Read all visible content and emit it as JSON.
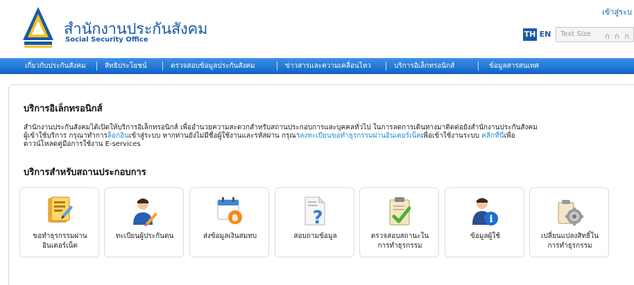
{
  "header": {
    "logo_thai": "สำนักงานประกันสังคม",
    "logo_en": "Social Security Office",
    "login_link": "เข้าสู่ระบ",
    "lang_th": "TH",
    "lang_en": "EN",
    "textsize_label": "Text Size",
    "textsize_options": "ก ก ก"
  },
  "nav": {
    "items": [
      "เกี่ยวกับประกันสังคม",
      "สิทธิประโยชน์",
      "ตรวจสอบข้อมูลประกันสังคม",
      "ข่าวสารและความเคลื่อนไหว",
      "บริการอิเล็กทรอนิกส์",
      "ข้อมูลสารสนเทศ"
    ]
  },
  "main": {
    "title": "บริการอิเล็กทรอนิกส์",
    "intro_line1": "สำนักงานประกันสังคมได้เปิดให้บริการอิเล็กทรอนิกส์ เพื่ออำนวยความสะดวกสำหรับสถานประกอบการและบุคคลทั่วไป ในการลดการเดินทางมาติดต่อยังสำนักงานประกันสังคม",
    "intro_part_a": "ผู้เข้าใช้บริการ กรุณาทำการ",
    "intro_link_login": "ล็อกอิน",
    "intro_part_b": "เข้าสู่ระบบ หากท่านยังไม่มีชื่อผู้ใช้งานและรหัสผ่าน กรุณา",
    "intro_link_register": "ลงทะเบียนขอทำธุรกรรมผ่านอินเตอร์เน็ต",
    "intro_part_c": "เพื่อเข้าใช้งานระบบ ",
    "intro_link_click": "คลิกที่นี่",
    "intro_part_d": "เพื่อ",
    "intro_line3": "ดาวน์โหลดคู่มือการใช้งาน E-services",
    "services_title": "บริการสำหรับสถานประกอบการ"
  },
  "services": [
    {
      "label": "ขอทำธุรกรรมผ่าน อินเตอร์เน็ต",
      "icon": "internet-transaction-icon"
    },
    {
      "label": "ทะเบียนผู้ประกันตน",
      "icon": "insured-registration-icon"
    },
    {
      "label": "ส่งข้อมูลเงินสมทบ",
      "icon": "contribution-submit-icon"
    },
    {
      "label": "สอบถามข้อมูล",
      "icon": "inquiry-icon"
    },
    {
      "label": "ตรวจสอบสถานะใน การทำธุรกรรม",
      "icon": "status-check-icon"
    },
    {
      "label": "ข้อมูลผู้ใช้",
      "icon": "user-info-icon"
    },
    {
      "label": "เปลี่ยนแปลงสิทธิ์ใน การทำธุรกรรม",
      "icon": "change-rights-icon"
    }
  ],
  "colors": {
    "brand_blue": "#1a5aa8",
    "nav_top": "#3d8fe6",
    "nav_bottom": "#1266c9",
    "link": "#1a8fd6"
  }
}
